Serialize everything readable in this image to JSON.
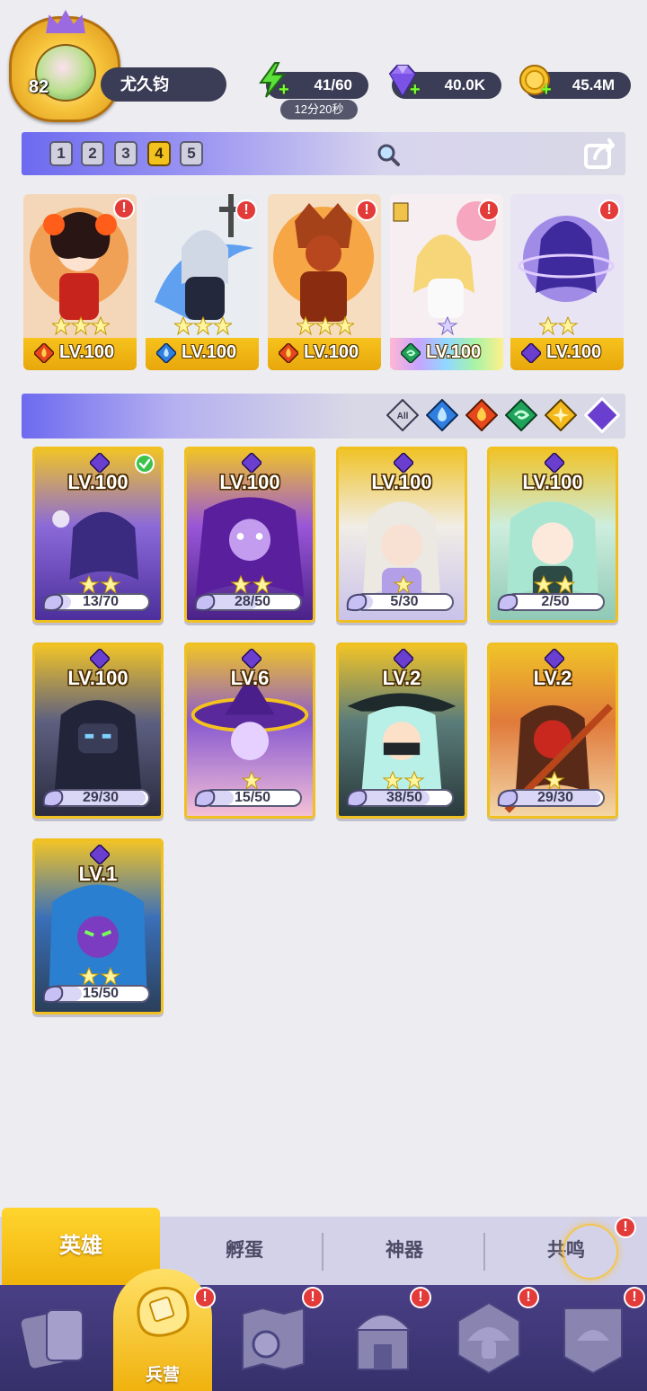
{
  "player": {
    "level": "82",
    "name": "尤久钧"
  },
  "resources": {
    "energy": "41/60",
    "energy_timer": "12分20秒",
    "gems": "40.0K",
    "gold": "45.4M"
  },
  "team_tabs": [
    "1",
    "2",
    "3",
    "4",
    "5"
  ],
  "active_team_tab": "4",
  "team_heroes": [
    {
      "level": "LV.100",
      "element": "fire",
      "alert": "!"
    },
    {
      "level": "LV.100",
      "element": "water",
      "alert": "!"
    },
    {
      "level": "LV.100",
      "element": "fire",
      "alert": "!"
    },
    {
      "level": "LV.100",
      "element": "wind",
      "alert": "!"
    },
    {
      "level": "LV.100",
      "element": "dark",
      "alert": "!"
    }
  ],
  "filters": {
    "all_label": "All",
    "elements": [
      "water",
      "fire",
      "wind",
      "light",
      "dark"
    ],
    "selected": "dark"
  },
  "heroes": [
    {
      "level": "LV.100",
      "shards": "13/70",
      "shard_fraction": 0.19,
      "theme": "purple-dark",
      "selected": true
    },
    {
      "level": "LV.100",
      "shards": "28/50",
      "shard_fraction": 0.56,
      "theme": "purple-violet",
      "selected": false
    },
    {
      "level": "LV.100",
      "shards": "5/30",
      "shard_fraction": 0.17,
      "theme": "white-gold",
      "selected": false
    },
    {
      "level": "LV.100",
      "shards": "2/50",
      "shard_fraction": 0.04,
      "theme": "mint-gold",
      "selected": false
    },
    {
      "level": "LV.100",
      "shards": "29/30",
      "shard_fraction": 0.97,
      "theme": "steel-dark",
      "selected": false
    },
    {
      "level": "LV.6",
      "shards": "15/50",
      "shard_fraction": 0.3,
      "theme": "purple-gold",
      "selected": false
    },
    {
      "level": "LV.2",
      "shards": "38/50",
      "shard_fraction": 0.76,
      "theme": "teal-dark",
      "selected": false
    },
    {
      "level": "LV.2",
      "shards": "29/30",
      "shard_fraction": 0.97,
      "theme": "red-gold",
      "selected": false
    },
    {
      "level": "LV.1",
      "shards": "15/50",
      "shard_fraction": 0.3,
      "theme": "blue-green",
      "selected": false
    }
  ],
  "subtabs": {
    "heroes": "英雄",
    "hatch": "孵蛋",
    "artifact": "神器",
    "resonance": "共鸣",
    "resonance_alert": "!"
  },
  "mainnav": {
    "barracks_label": "兵营",
    "alert": "!"
  },
  "colors": {
    "accent_gold": "#f4c21f",
    "panel_purple": "#6d6af0",
    "alert_red": "#e33a3a"
  }
}
